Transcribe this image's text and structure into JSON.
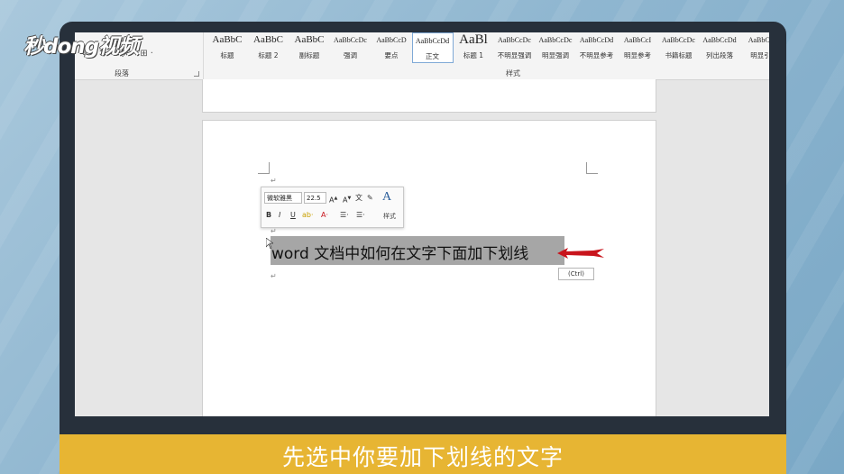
{
  "logo": {
    "text": "秒dong视频"
  },
  "ribbon": {
    "paragraph_group_label": "段落",
    "styles_group_label": "样式",
    "styles": [
      {
        "sample": "AaBbC",
        "name": "标题"
      },
      {
        "sample": "AaBbC",
        "name": "标题 2"
      },
      {
        "sample": "AaBbC",
        "name": "副标题"
      },
      {
        "sample": "AaBbCcDc",
        "name": "强调"
      },
      {
        "sample": "AaBbCcD",
        "name": "要点"
      },
      {
        "sample": "AaBbCcDd",
        "name": "正文"
      },
      {
        "sample": "AaBl",
        "name": "标题 1"
      },
      {
        "sample": "AaBbCcDc",
        "name": "不明显强调"
      },
      {
        "sample": "AaBbCcDc",
        "name": "明显强调"
      },
      {
        "sample": "AaBbCcDd",
        "name": "不明显参考"
      },
      {
        "sample": "AaBbCcI",
        "name": "明显参考"
      },
      {
        "sample": "AaBbCcDc",
        "name": "书籍标题"
      },
      {
        "sample": "AaBbCcDd",
        "name": "列出段落"
      },
      {
        "sample": "AaBbCc",
        "name": "明显引"
      }
    ],
    "active_style": "正文"
  },
  "mini_toolbar": {
    "font": "微软雅黑",
    "size": "22.5",
    "styles_label": "样式",
    "bold": "B",
    "italic": "I",
    "underline": "U"
  },
  "document": {
    "selected_text": "word 文档中如何在文字下面加下划线",
    "paste_options": "(Ctrl)"
  },
  "subtitle": "先选中你要加下划线的文字",
  "colors": {
    "selection": "#a6a6a6",
    "subtitle_bar": "#e7b533",
    "arrow": "#c8141c",
    "monitor": "#27303b"
  }
}
